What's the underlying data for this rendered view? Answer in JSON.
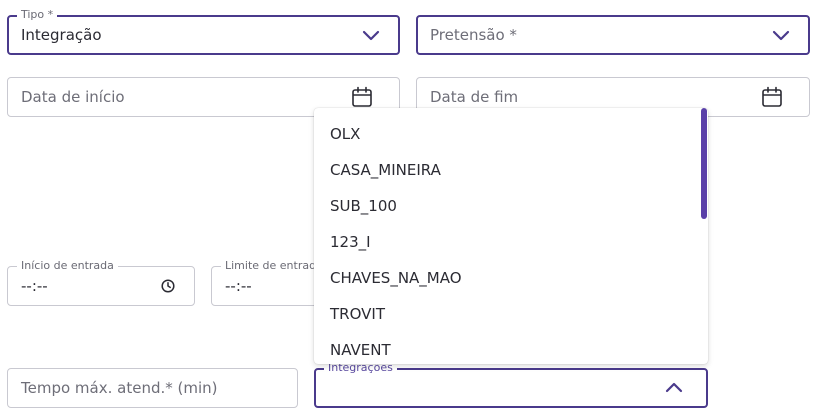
{
  "form": {
    "tipo": {
      "label": "Tipo *",
      "value": "Integração"
    },
    "pretensao": {
      "placeholder": "Pretensão *"
    },
    "data_inicio": {
      "placeholder": "Data de início"
    },
    "data_fim": {
      "placeholder": "Data de fim"
    },
    "inicio_entrada": {
      "label": "Início de entrada",
      "value": "--:--"
    },
    "limite_entrada": {
      "label": "Limite de entrad",
      "value": "--:--"
    },
    "tempo_max": {
      "placeholder": "Tempo máx. atend.* (min)"
    },
    "integracoes": {
      "label": "Integrações"
    }
  },
  "dropdown": {
    "items": [
      "OLX",
      "CASA_MINEIRA",
      "SUB_100",
      "123_I",
      "CHAVES_NA_MAO",
      "TROVIT",
      "NAVENT"
    ]
  },
  "colors": {
    "accent": "#4a3a8c",
    "scrollbar": "#5a40a8",
    "border": "#c9c9d1"
  },
  "icons": {
    "select": "chevron-down-icon",
    "select_open": "chevron-up-icon",
    "date": "calendar-icon",
    "time": "clock-icon"
  }
}
